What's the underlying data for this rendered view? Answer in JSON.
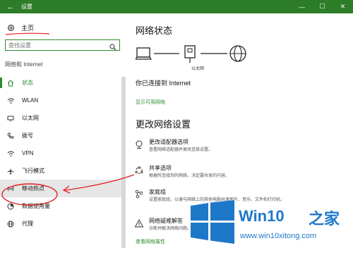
{
  "window": {
    "title": "设置",
    "back_glyph": "←",
    "minimize_glyph": "—",
    "maximize_glyph": "☐",
    "close_glyph": "✕"
  },
  "sidebar": {
    "home_label": "主页",
    "search_placeholder": "查找设置",
    "section_label": "网络和 Internet",
    "items": [
      {
        "label": "状态",
        "icon": "home-status-icon"
      },
      {
        "label": "WLAN",
        "icon": "wifi-icon"
      },
      {
        "label": "以太网",
        "icon": "ethernet-icon"
      },
      {
        "label": "拨号",
        "icon": "phone-icon"
      },
      {
        "label": "VPN",
        "icon": "vpn-icon"
      },
      {
        "label": "飞行模式",
        "icon": "airplane-icon"
      },
      {
        "label": "移动热点",
        "icon": "hotspot-icon"
      },
      {
        "label": "数据使用量",
        "icon": "data-usage-icon"
      },
      {
        "label": "代理",
        "icon": "globe-icon"
      }
    ]
  },
  "main": {
    "status_title": "网络状态",
    "diagram_caption": "以太网",
    "connected_text": "你已连接到 Internet",
    "show_networks_link": "显示可用网络",
    "change_title": "更改网络设置",
    "options": [
      {
        "title": "更改适配器选项",
        "desc": "查看网络适配器并更改连接设置。",
        "icon": "adapter-icon"
      },
      {
        "title": "共享选项",
        "desc": "根据所连接到的网络，决定要共享的内容。",
        "icon": "sharing-icon"
      },
      {
        "title": "家庭组",
        "desc": "设置家庭组，以便与网络上的其他电脑共享图片、音乐、文件和打印机。",
        "icon": "homegroup-icon"
      },
      {
        "title": "网络疑难解答",
        "desc": "诊断并解决网络问题。",
        "icon": "warning-icon"
      }
    ],
    "properties_link": "查看网络属性"
  },
  "watermark": {
    "brand": "Win10",
    "brand_suffix": "之家",
    "url": "www.win10xitong.com"
  },
  "colors": {
    "accent": "#2e8b2e",
    "titlebar": "#2d7d28",
    "annotation": "#e02020",
    "watermark": "#1e78c8"
  }
}
